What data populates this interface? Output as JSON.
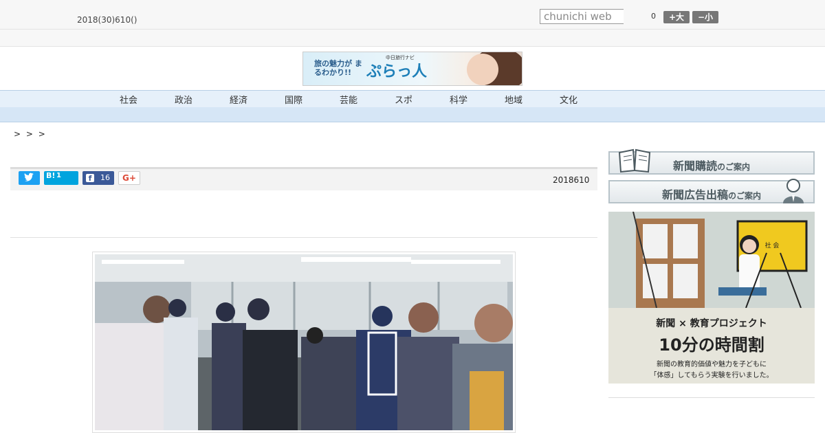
{
  "header": {
    "date_text": "2018(30)610()",
    "search_placeholder": "chunichi web",
    "count": "0",
    "font_larger": "+大",
    "font_smaller": "−小"
  },
  "banner": {
    "tagline": "旅の魅力が まるわかり!!",
    "brand": "ぷらっ人",
    "sub": "中日旅行ナビ"
  },
  "nav": {
    "items": [
      "社会",
      "政治",
      "経済",
      "国際",
      "芸能",
      "スポ",
      "科学",
      "地域",
      "文化"
    ]
  },
  "breadcrumb": "> > >",
  "share": {
    "hatena_label": "B!",
    "hatena_count": "1",
    "facebook_count": "16",
    "gplus_label": "G+"
  },
  "article": {
    "date": "2018610"
  },
  "sidebar": {
    "subscribe_main": "新聞購読",
    "subscribe_sub": "のご案内",
    "ad_main": "新聞広告出稿",
    "ad_sub": "のご案内",
    "promo_line1": "新聞 × 教育プロジェクト",
    "promo_line2": "10分の時間割",
    "promo_line3": "新聞の教育的価値や魅力を子どもに",
    "promo_line4": "「体感」してもらう実験を行いました。",
    "promo_board": "社 会"
  }
}
